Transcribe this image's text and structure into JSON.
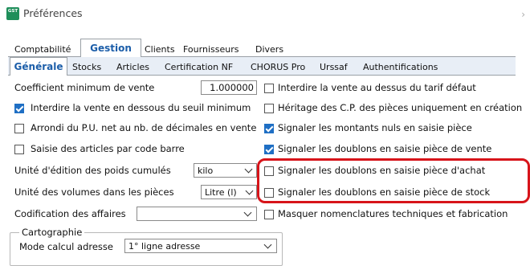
{
  "window": {
    "title": "Préférences",
    "app_icon_text": "GST",
    "app_color": "#1e8e5a"
  },
  "main_tabs": [
    {
      "label": "Comptabilité",
      "active": false
    },
    {
      "label": "Gestion",
      "active": true
    },
    {
      "label": "Clients",
      "active": false
    },
    {
      "label": "Fournisseurs",
      "active": false
    },
    {
      "label": "Divers",
      "active": false
    }
  ],
  "sub_tabs": [
    {
      "label": "Générale",
      "active": true
    },
    {
      "label": "Stocks",
      "active": false
    },
    {
      "label": "Articles",
      "active": false
    },
    {
      "label": "Certification NF",
      "active": false
    },
    {
      "label": "CHORUS Pro",
      "active": false
    },
    {
      "label": "Urssaf",
      "active": false
    },
    {
      "label": "Authentifications",
      "active": false
    }
  ],
  "left": {
    "coef_label": "Coefficient minimum de vente",
    "coef_value": "1.000000",
    "checkboxes": [
      {
        "label": "Interdire la vente en dessous du seuil minimum",
        "checked": true
      },
      {
        "label": "Arrondi du P.U. net au nb. de décimales en vente",
        "checked": false
      },
      {
        "label": "Saisie des articles par code barre",
        "checked": false
      }
    ],
    "poids_label": "Unité d'édition des poids cumulés",
    "poids_value": "kilo",
    "volumes_label": "Unité des volumes dans les pièces",
    "volumes_value": "Litre (l)",
    "affaires_label": "Codification des affaires",
    "affaires_value": "",
    "group_title": "Cartographie",
    "mode_label": "Mode calcul adresse",
    "mode_value": "1° ligne adresse"
  },
  "right": {
    "checkboxes": [
      {
        "label": "Interdire la vente au dessus du tarif défaut",
        "checked": false
      },
      {
        "label": "Héritage des C.P. des pièces uniquement en création",
        "checked": false
      },
      {
        "label": "Signaler les montants nuls en saisie pièce",
        "checked": true
      },
      {
        "label": "Signaler les doublons en saisie pièce de vente",
        "checked": true
      },
      {
        "label": "Signaler les doublons en saisie pièce d'achat",
        "checked": false
      },
      {
        "label": "Signaler les doublons en saisie pièce de stock",
        "checked": false
      },
      {
        "label": "Masquer nomenclatures techniques et fabrication",
        "checked": false
      }
    ]
  },
  "colors": {
    "accent": "#1c5ea9",
    "checkbox": "#1f6fc4",
    "highlight": "#d7141a",
    "subtab_strip": "#e8eef6"
  }
}
